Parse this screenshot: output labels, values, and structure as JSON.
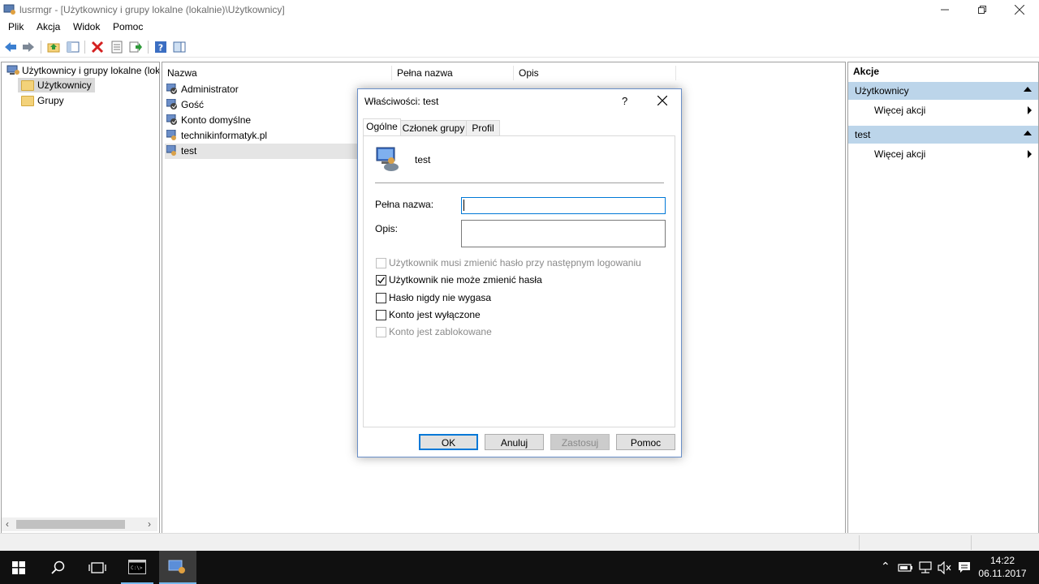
{
  "window": {
    "title": "lusrmgr - [Użytkownicy i grupy lokalne (lokalnie)\\Użytkownicy]"
  },
  "menu": [
    "Plik",
    "Akcja",
    "Widok",
    "Pomoc"
  ],
  "tree": {
    "root": "Użytkownicy i grupy lokalne (lok",
    "items": [
      "Użytkownicy",
      "Grupy"
    ]
  },
  "list": {
    "columns": [
      "Nazwa",
      "Pełna nazwa",
      "Opis"
    ],
    "rows": [
      {
        "name": "Administrator"
      },
      {
        "name": "Gość"
      },
      {
        "name": "Konto domyślne"
      },
      {
        "name": "technikinformatyk.pl"
      },
      {
        "name": "test"
      }
    ]
  },
  "actions": {
    "header": "Akcje",
    "sections": [
      {
        "title": "Użytkownicy",
        "item": "Więcej akcji"
      },
      {
        "title": "test",
        "item": "Więcej akcji"
      }
    ]
  },
  "dialog": {
    "title": "Właściwości: test",
    "help_symbol": "?",
    "tabs": [
      "Ogólne",
      "Członek grupy",
      "Profil"
    ],
    "username": "test",
    "fields": {
      "fullname_label": "Pełna nazwa:",
      "fullname_value": "",
      "desc_label": "Opis:",
      "desc_value": ""
    },
    "checkboxes": [
      {
        "label": "Użytkownik musi zmienić hasło przy następnym logowaniu",
        "checked": false,
        "enabled": false
      },
      {
        "label": "Użytkownik nie może zmienić hasła",
        "checked": true,
        "enabled": true
      },
      {
        "label": "Hasło nigdy nie wygasa",
        "checked": false,
        "enabled": true
      },
      {
        "label": "Konto jest wyłączone",
        "checked": false,
        "enabled": true
      },
      {
        "label": "Konto jest zablokowane",
        "checked": false,
        "enabled": false
      }
    ],
    "buttons": {
      "ok": "OK",
      "cancel": "Anuluj",
      "apply": "Zastosuj",
      "help": "Pomoc"
    }
  },
  "taskbar": {
    "time": "14:22",
    "date": "06.11.2017"
  },
  "colors": {
    "accent": "#0078d7",
    "actions_header": "#bcd5ea",
    "selection": "#cce8ff"
  },
  "icons": [
    "back-icon",
    "forward-icon",
    "up-folder-icon",
    "show-hide-tree-icon",
    "delete-icon",
    "properties-icon",
    "export-icon",
    "help-icon",
    "action-pane-icon"
  ]
}
